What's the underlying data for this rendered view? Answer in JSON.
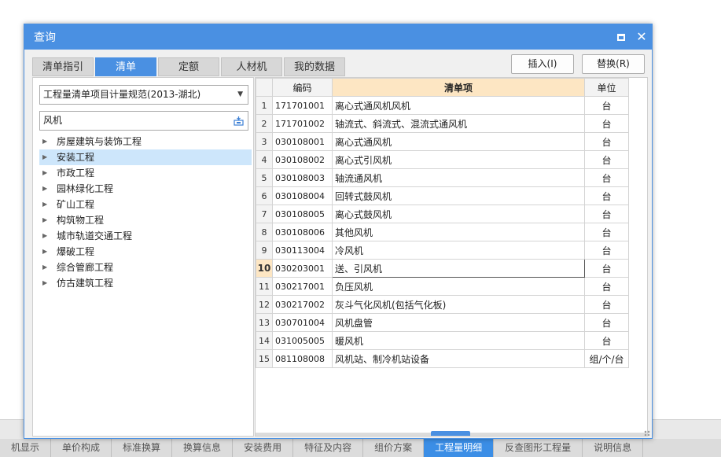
{
  "window": {
    "title": "查询"
  },
  "tabs": [
    "清单指引",
    "清单",
    "定额",
    "人材机",
    "我的数据"
  ],
  "active_tab_index": 1,
  "buttons": {
    "insert": "插入(I)",
    "replace": "替换(R)"
  },
  "left": {
    "spec_select": "工程量清单项目计量规范(2013-湖北)",
    "search_value": "风机",
    "tree": [
      "房屋建筑与装饰工程",
      "安装工程",
      "市政工程",
      "园林绿化工程",
      "矿山工程",
      "构筑物工程",
      "城市轨道交通工程",
      "爆破工程",
      "综合管廊工程",
      "仿古建筑工程"
    ],
    "selected_index": 1
  },
  "grid": {
    "headers": {
      "code": "编码",
      "name": "清单项",
      "unit": "单位"
    },
    "current_row": 9,
    "rows": [
      {
        "n": "1",
        "code": "171701001",
        "name": "离心式通风机风机",
        "unit": "台"
      },
      {
        "n": "2",
        "code": "171701002",
        "name": "轴流式、斜流式、混流式通风机",
        "unit": "台"
      },
      {
        "n": "3",
        "code": "030108001",
        "name": "离心式通风机",
        "unit": "台"
      },
      {
        "n": "4",
        "code": "030108002",
        "name": "离心式引风机",
        "unit": "台"
      },
      {
        "n": "5",
        "code": "030108003",
        "name": "轴流通风机",
        "unit": "台"
      },
      {
        "n": "6",
        "code": "030108004",
        "name": "回转式鼓风机",
        "unit": "台"
      },
      {
        "n": "7",
        "code": "030108005",
        "name": "离心式鼓风机",
        "unit": "台"
      },
      {
        "n": "8",
        "code": "030108006",
        "name": "其他风机",
        "unit": "台"
      },
      {
        "n": "9",
        "code": "030113004",
        "name": "冷风机",
        "unit": "台"
      },
      {
        "n": "10",
        "code": "030203001",
        "name": "送、引风机",
        "unit": "台"
      },
      {
        "n": "11",
        "code": "030217001",
        "name": "负压风机",
        "unit": "台"
      },
      {
        "n": "12",
        "code": "030217002",
        "name": "灰斗气化风机(包括气化板)",
        "unit": "台"
      },
      {
        "n": "13",
        "code": "030701004",
        "name": "风机盘管",
        "unit": "台"
      },
      {
        "n": "14",
        "code": "031005005",
        "name": "暖风机",
        "unit": "台"
      },
      {
        "n": "15",
        "code": "081108008",
        "name": "风机站、制冷机站设备",
        "unit": "组/个/台"
      }
    ]
  },
  "background_tabs": [
    "机显示",
    "单价构成",
    "标准换算",
    "换算信息",
    "安装费用",
    "特征及内容",
    "组价方案",
    "工程量明细",
    "反查图形工程量",
    "说明信息"
  ],
  "background_active_index": 7,
  "colors": {
    "accent": "#4a90e2",
    "header_highlight": "#fde6c3",
    "selection": "#cde6fb"
  }
}
